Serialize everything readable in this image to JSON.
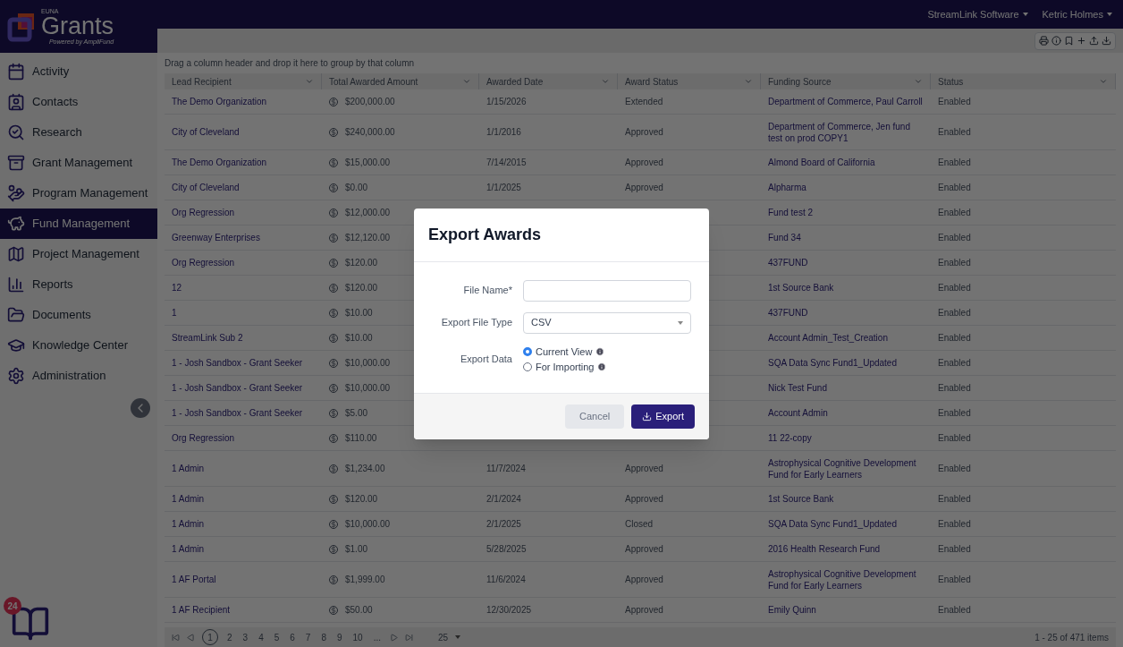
{
  "logo": {
    "brand": "EUNA",
    "product": "Grants",
    "tagline": "Powered by AmpliFund"
  },
  "header": {
    "menus": [
      {
        "label": "StreamLink Software"
      },
      {
        "label": "Ketric Holmes"
      }
    ]
  },
  "sidebar": {
    "items": [
      {
        "label": "Activity",
        "selected": false
      },
      {
        "label": "Contacts",
        "selected": false
      },
      {
        "label": "Research",
        "selected": false
      },
      {
        "label": "Grant Management",
        "selected": false
      },
      {
        "label": "Program Management",
        "selected": false
      },
      {
        "label": "Fund Management",
        "selected": true
      },
      {
        "label": "Project Management",
        "selected": false
      },
      {
        "label": "Reports",
        "selected": false
      },
      {
        "label": "Documents",
        "selected": false
      },
      {
        "label": "Knowledge Center",
        "selected": false
      },
      {
        "label": "Administration",
        "selected": false
      }
    ],
    "badge": "24"
  },
  "table": {
    "group_hint": "Drag a column header and drop it here to group by that column",
    "columns": [
      "Lead Recipient",
      "Total Awarded Amount",
      "Awarded Date",
      "Award Status",
      "Funding Source",
      "Status"
    ],
    "rows": [
      {
        "recipient": "The Demo Organization",
        "amount": "$200,000.00",
        "date": "1/15/2026",
        "award_status": "Extended",
        "source": "Department of Commerce, Paul Carroll",
        "status": "Enabled"
      },
      {
        "recipient": "City of Cleveland",
        "amount": "$240,000.00",
        "date": "1/1/2016",
        "award_status": "Approved",
        "source": "Department of Commerce, Jen fund test on prod COPY1",
        "status": "Enabled"
      },
      {
        "recipient": "The Demo Organization",
        "amount": "$15,000.00",
        "date": "7/14/2015",
        "award_status": "Approved",
        "source": "Almond Board of California",
        "status": "Enabled"
      },
      {
        "recipient": "City of Cleveland",
        "amount": "$0.00",
        "date": "1/1/2025",
        "award_status": "Approved",
        "source": "Alpharma",
        "status": "Enabled"
      },
      {
        "recipient": "Org Regression",
        "amount": "$12,000.00",
        "source": "Fund test 2",
        "status": "Enabled"
      },
      {
        "recipient": "Greenway Enterprises",
        "amount": "$12,120.00",
        "source": "Fund 34",
        "status": "Enabled"
      },
      {
        "recipient": "Org Regression",
        "amount": "$120.00",
        "source": "437FUND",
        "status": "Enabled"
      },
      {
        "recipient": "12",
        "amount": "$120.00",
        "source": "1st Source Bank",
        "status": "Enabled"
      },
      {
        "recipient": "1",
        "amount": "$10.00",
        "source": "437FUND",
        "status": "Enabled"
      },
      {
        "recipient": "StreamLink Sub 2",
        "amount": "$10.00",
        "source": "Account Admin_Test_Creation",
        "status": "Enabled"
      },
      {
        "recipient": "1 - Josh Sandbox - Grant Seeker",
        "amount": "$10,000.00",
        "source": "SQA Data Sync Fund1_Updated",
        "status": "Enabled"
      },
      {
        "recipient": "1 - Josh Sandbox - Grant Seeker",
        "amount": "$10,000.00",
        "source": "Nick Test Fund",
        "status": "Enabled"
      },
      {
        "recipient": "1 - Josh Sandbox - Grant Seeker",
        "amount": "$5.00",
        "source": "Account Admin",
        "status": "Enabled"
      },
      {
        "recipient": "Org Regression",
        "amount": "$110.00",
        "source": "11 22-copy",
        "status": "Enabled"
      },
      {
        "recipient": "1 Admin",
        "amount": "$1,234.00",
        "date": "11/7/2024",
        "award_status": "Approved",
        "source": "Astrophysical Cognitive Development Fund for Early Learners",
        "status": "Enabled"
      },
      {
        "recipient": "1 Admin",
        "amount": "$120.00",
        "date": "2/1/2024",
        "award_status": "Approved",
        "source": "1st Source Bank",
        "status": "Enabled"
      },
      {
        "recipient": "1 Admin",
        "amount": "$10,000.00",
        "date": "2/1/2025",
        "award_status": "Closed",
        "source": "SQA Data Sync Fund1_Updated",
        "status": "Enabled"
      },
      {
        "recipient": "1 Admin",
        "amount": "$1.00",
        "date": "5/28/2025",
        "award_status": "Approved",
        "source": "2016 Health Research Fund",
        "status": "Enabled"
      },
      {
        "recipient": "1 AF Portal",
        "amount": "$1,999.00",
        "date": "11/6/2024",
        "award_status": "Approved",
        "source": "Astrophysical Cognitive Development Fund for Early Learners",
        "status": "Enabled"
      },
      {
        "recipient": "1 AF Recipient",
        "amount": "$50.00",
        "date": "12/30/2025",
        "award_status": "Approved",
        "source": "Emily Quinn",
        "status": "Enabled"
      }
    ]
  },
  "pager": {
    "pages": [
      {
        "label": "1",
        "selected": true
      },
      {
        "label": "2",
        "selected": false
      },
      {
        "label": "3",
        "selected": false
      },
      {
        "label": "4",
        "selected": false
      },
      {
        "label": "5",
        "selected": false
      },
      {
        "label": "6",
        "selected": false
      },
      {
        "label": "7",
        "selected": false
      },
      {
        "label": "8",
        "selected": false
      },
      {
        "label": "9",
        "selected": false
      },
      {
        "label": "10",
        "selected": false
      },
      {
        "label": "...",
        "selected": false
      }
    ],
    "page_size": "25",
    "summary": "1 - 25 of 471 items"
  },
  "dialog": {
    "title": "Export Awards",
    "fields": [
      {
        "kind": "text",
        "label": "File Name*"
      },
      {
        "kind": "select",
        "label": "Export File Type",
        "value": "CSV"
      },
      {
        "kind": "radio",
        "label": "Export Data",
        "options": [
          {
            "label": "Current View",
            "selected": true
          },
          {
            "label": "For Importing",
            "selected": false
          }
        ]
      }
    ],
    "buttons": [
      {
        "label": "Cancel",
        "kind": "secondary"
      },
      {
        "label": "Export",
        "kind": "primary"
      }
    ]
  }
}
